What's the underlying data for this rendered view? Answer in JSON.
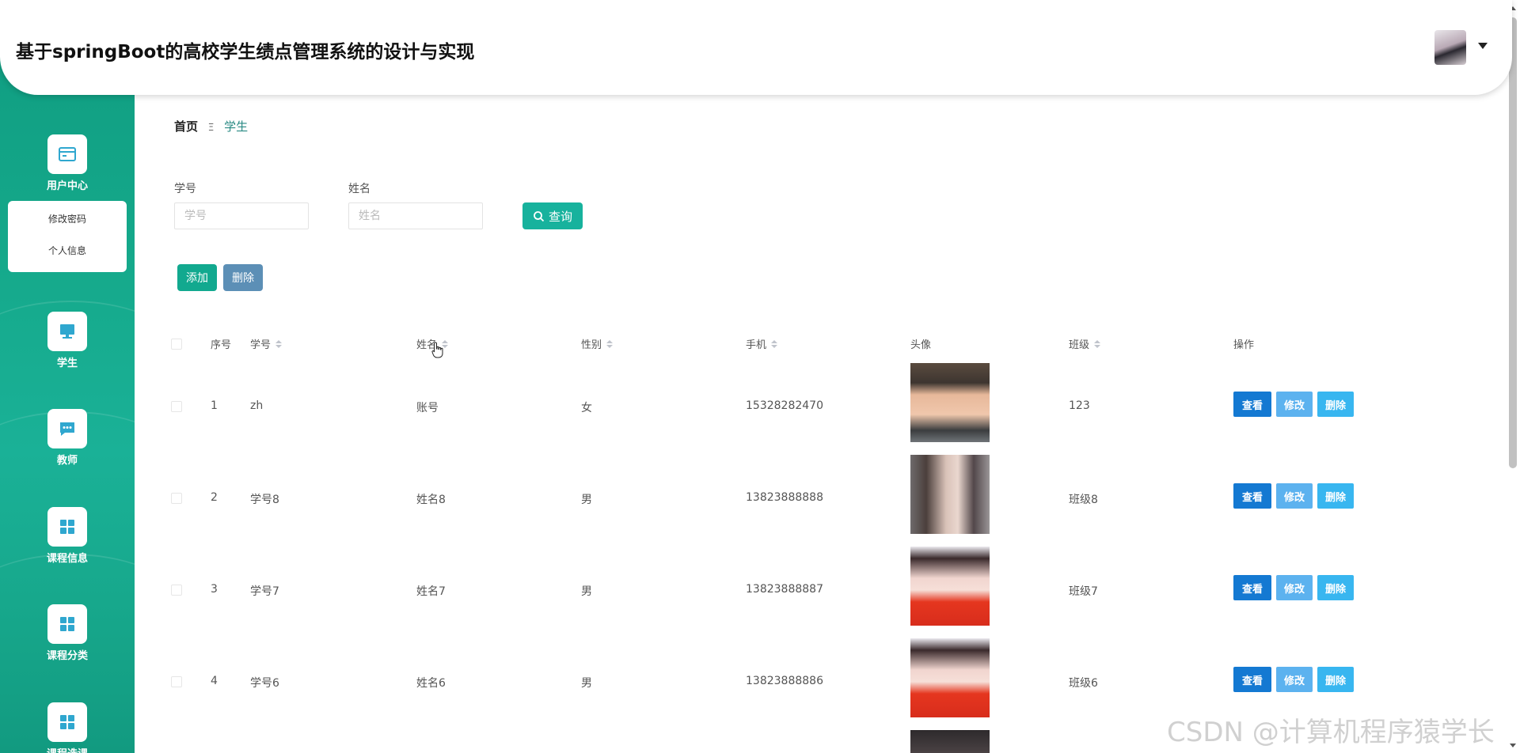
{
  "header": {
    "title": "基于springBoot的高校学生绩点管理系统的设计与实现",
    "avatar_icon": "user-avatar",
    "dropdown_icon": "caret-down-icon"
  },
  "sidebar": {
    "items": [
      {
        "label": "用户中心",
        "icon": "card-icon"
      },
      {
        "label": "学生",
        "icon": "monitor-icon"
      },
      {
        "label": "教师",
        "icon": "chat-icon"
      },
      {
        "label": "课程信息",
        "icon": "grid-icon"
      },
      {
        "label": "课程分类",
        "icon": "grid-icon"
      },
      {
        "label": "课程选课",
        "icon": "grid-icon"
      }
    ],
    "submenu": [
      "修改密码",
      "个人信息"
    ]
  },
  "breadcrumb": {
    "home": "首页",
    "separator": "Ξ",
    "current": "学生"
  },
  "search": {
    "fields": [
      {
        "label": "学号",
        "placeholder": "学号"
      },
      {
        "label": "姓名",
        "placeholder": "姓名"
      }
    ],
    "query_label": "查询"
  },
  "actions": {
    "add": "添加",
    "delete": "删除"
  },
  "table": {
    "headers": {
      "index": "序号",
      "student_no": "学号",
      "name": "姓名",
      "gender": "性别",
      "phone": "手机",
      "avatar": "头像",
      "class": "班级",
      "ops": "操作"
    },
    "rows": [
      {
        "index": "1",
        "student_no": "zh",
        "name": "账号",
        "gender": "女",
        "phone": "15328282470",
        "class": "123"
      },
      {
        "index": "2",
        "student_no": "学号8",
        "name": "姓名8",
        "gender": "男",
        "phone": "13823888888",
        "class": "班级8"
      },
      {
        "index": "3",
        "student_no": "学号7",
        "name": "姓名7",
        "gender": "男",
        "phone": "13823888887",
        "class": "班级7"
      },
      {
        "index": "4",
        "student_no": "学号6",
        "name": "姓名6",
        "gender": "男",
        "phone": "13823888886",
        "class": "班级6"
      }
    ],
    "row_actions": {
      "view": "查看",
      "edit": "修改",
      "delete": "删除"
    }
  },
  "watermark": "CSDN @计算机程序猿学长",
  "colors": {
    "sidebar": "#15a98b",
    "primary": "#17b29d",
    "view": "#1479d2",
    "edit": "#5cb2ef",
    "delete": "#38b6f0"
  }
}
